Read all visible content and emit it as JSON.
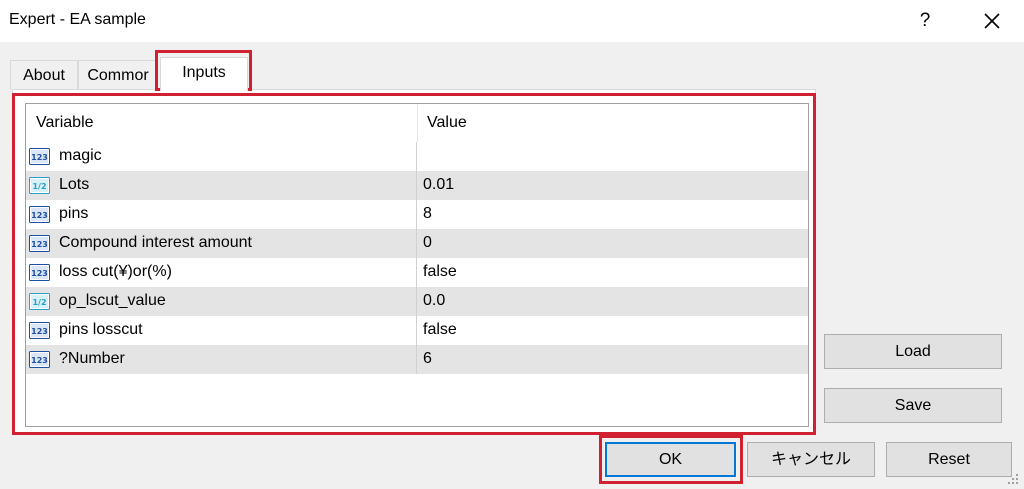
{
  "window": {
    "title": "Expert - EA sample",
    "help_label": "?"
  },
  "tabs": [
    {
      "label": "About"
    },
    {
      "label": "Commor"
    },
    {
      "label": "Inputs"
    }
  ],
  "table": {
    "headers": {
      "variable": "Variable",
      "value": "Value"
    },
    "rows": [
      {
        "variable": "magic",
        "value": "",
        "icon": "integer-icon"
      },
      {
        "variable": "Lots",
        "value": "0.01",
        "icon": "double-icon"
      },
      {
        "variable": "pins",
        "value": "8",
        "icon": "integer-icon"
      },
      {
        "variable": "Compound interest amount",
        "value": "0",
        "icon": "integer-icon"
      },
      {
        "variable": "loss cut(¥)or(%)",
        "value": "false",
        "icon": "integer-icon"
      },
      {
        "variable": "op_lscut_value",
        "value": "0.0",
        "icon": "double-icon"
      },
      {
        "variable": "pins losscut",
        "value": "false",
        "icon": "integer-icon"
      },
      {
        "variable": "?Number",
        "value": "6",
        "icon": "integer-icon"
      }
    ]
  },
  "buttons": {
    "load": "Load",
    "save": "Save",
    "ok": "OK",
    "cancel": "キャンセル",
    "reset": "Reset"
  },
  "icon_text": {
    "integer": "123",
    "double": "1/2"
  },
  "colors": {
    "highlight": "#d1202f",
    "focus": "#0078d7",
    "int_icon": "#1e4fa0",
    "double_icon": "#2a9fc8"
  }
}
